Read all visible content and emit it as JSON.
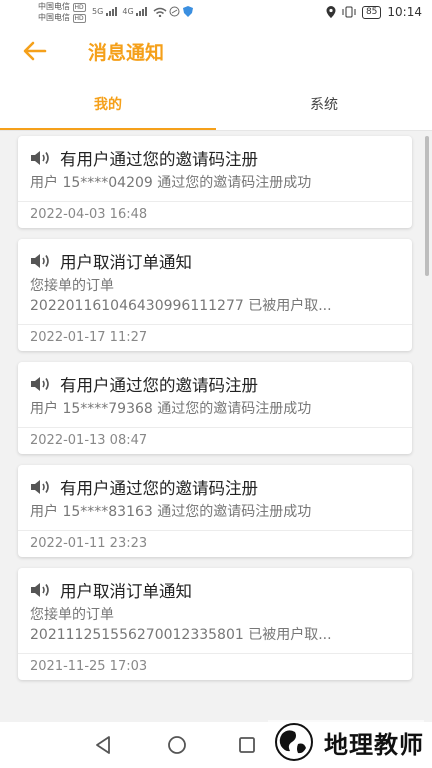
{
  "status_bar": {
    "carrier_1": "中国电信",
    "carrier_1_badge": "HD",
    "carrier_2": "中国电信",
    "carrier_2_badge": "HD",
    "net_1": "5G",
    "net_2": "4G",
    "battery": "85",
    "time": "10:14"
  },
  "header": {
    "title": "消息通知"
  },
  "tabs": [
    {
      "label": "我的",
      "active": true
    },
    {
      "label": "系统",
      "active": false
    }
  ],
  "messages": [
    {
      "title": "有用户通过您的邀请码注册",
      "line1": "用户 15****04209 通过您的邀请码注册成功",
      "line2": "",
      "date": "2022-04-03 16:48"
    },
    {
      "title": "用户取消订单通知",
      "line1": "您接单的订单",
      "line2": "20220116104643099611127​7 已被用户取...",
      "date": "2022-01-17 11:27"
    },
    {
      "title": "有用户通过您的邀请码注册",
      "line1": "用户 15****79368 通过您的邀请码注册成功",
      "line2": "",
      "date": "2022-01-13 08:47"
    },
    {
      "title": "有用户通过您的邀请码注册",
      "line1": "用户 15****83163 通过您的邀请码注册成功",
      "line2": "",
      "date": "2022-01-11 23:23"
    },
    {
      "title": "用户取消订单通知",
      "line1": "您接单的订单",
      "line2": "20211125155627001233580​1 已被用户取...",
      "date": "2021-11-25 17:03"
    }
  ],
  "watermark": {
    "text": "地理教师"
  },
  "colors": {
    "accent": "#f5a01a",
    "background": "#f2f2f2"
  },
  "icons": {
    "back": "arrow-left-icon",
    "speaker": "speaker-icon",
    "nav_back": "triangle-back-icon",
    "nav_home": "circle-home-icon",
    "nav_recent": "square-recent-icon"
  }
}
